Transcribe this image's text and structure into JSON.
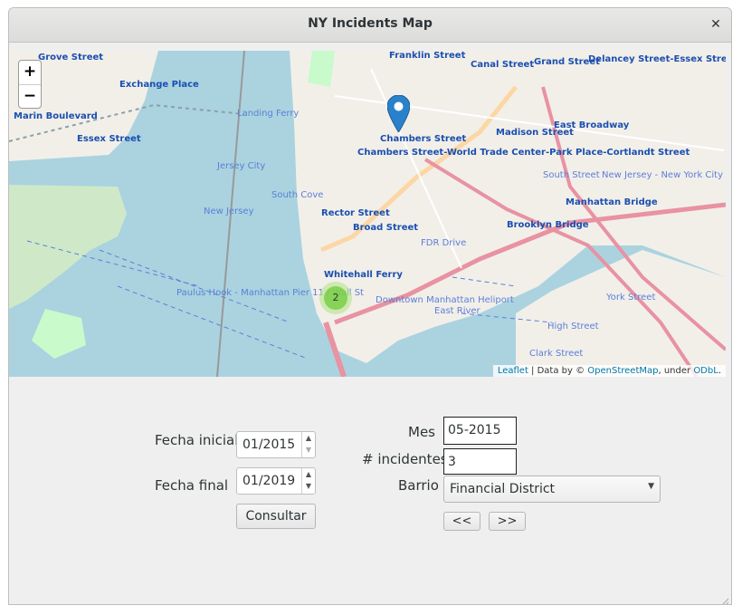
{
  "window": {
    "title": "NY Incidents Map",
    "close_glyph": "✕"
  },
  "map": {
    "zoom_in": "+",
    "zoom_out": "−",
    "cluster_count": "2",
    "attribution": {
      "leaflet": "Leaflet",
      "sep1": " | Data by © ",
      "osm": "OpenStreetMap",
      "sep2": ", under ",
      "odbl": "ODbL",
      "end": "."
    },
    "place_labels": [
      "Grove Street",
      "Exchange Place",
      "Marin Boulevard",
      "Essex Street",
      "Franklin Street",
      "Canal Street",
      "Grand Street",
      "Delancey Street-Essex Street",
      "Chambers Street",
      "Chambers Street-World Trade Center-Park Place-Cortlandt Street",
      "Madison Street",
      "East Broadway",
      "Manhattan Bridge",
      "Brooklyn Bridge",
      "Rector Street",
      "Broad Street",
      "Whitehall Ferry",
      "South Cove",
      "New Jersey",
      "Jersey City",
      "Landing Ferry",
      "Downtown Manhattan Heliport",
      "FDR Drive",
      "South Street",
      "York Street",
      "High Street",
      "Clark Street",
      "East River",
      "New Jersey - New York City",
      "Paulus Hook - Manhattan Pier 11 / Wall St"
    ]
  },
  "form": {
    "fecha_inicial_label": "Fecha inicial",
    "fecha_inicial_value": "01/2015",
    "fecha_final_label": "Fecha final",
    "fecha_final_value": "01/2019",
    "consultar_label": "Consultar",
    "mes_label": "Mes",
    "mes_value": "05-2015",
    "incidentes_label": "# incidentes",
    "incidentes_value": "3",
    "barrio_label": "Barrio",
    "barrio_value": "Financial District",
    "prev_label": "<<",
    "next_label": ">>"
  },
  "icons": {
    "close": "close-icon",
    "marker": "map-pin-icon",
    "spin_up": "spin-up-icon",
    "spin_down": "spin-down-icon",
    "dropdown": "chevron-down-icon"
  },
  "colors": {
    "water": "#aad3df",
    "land": "#f2efe9",
    "park": "#c8facc",
    "marker": "#2a81cb",
    "cluster": "#6ecc39"
  }
}
